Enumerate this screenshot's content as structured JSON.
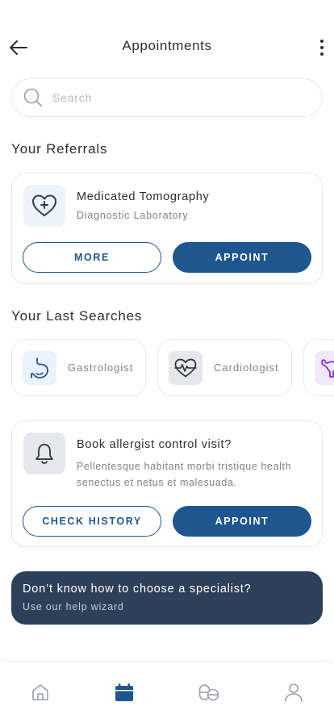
{
  "header": {
    "title": "Appointments"
  },
  "search": {
    "placeholder": "Search"
  },
  "referrals": {
    "section_title": "Your Referrals",
    "card": {
      "title": "Medicated Tomography",
      "subtitle": "Diagnostic Laboratory",
      "more_label": "MORE",
      "appoint_label": "APPOINT"
    }
  },
  "last_searches": {
    "section_title": "Your Last Searches",
    "items": [
      {
        "label": "Gastrologist",
        "icon": "stomach-icon"
      },
      {
        "label": "Cardiologist",
        "icon": "heartbeat-icon"
      },
      {
        "label": "",
        "icon": "uterus-icon"
      }
    ]
  },
  "reminder": {
    "title": "Book allergist control visit?",
    "description": "Pellentesque habitant morbi tristique health senectus et netus et malesuada.",
    "history_label": "CHECK HISTORY",
    "appoint_label": "APPOINT"
  },
  "help_banner": {
    "title": "Don’t know how to choose a specialist?",
    "subtitle": "Use our help wizard"
  },
  "tabbar": {
    "items": [
      {
        "icon": "home-icon",
        "active": false
      },
      {
        "icon": "calendar-icon",
        "active": true
      },
      {
        "icon": "pills-icon",
        "active": false
      },
      {
        "icon": "profile-icon",
        "active": false
      }
    ]
  },
  "colors": {
    "primary": "#1f5690",
    "banner_bg": "#2d405a",
    "text": "#2a2d33",
    "muted": "#7d828a"
  }
}
